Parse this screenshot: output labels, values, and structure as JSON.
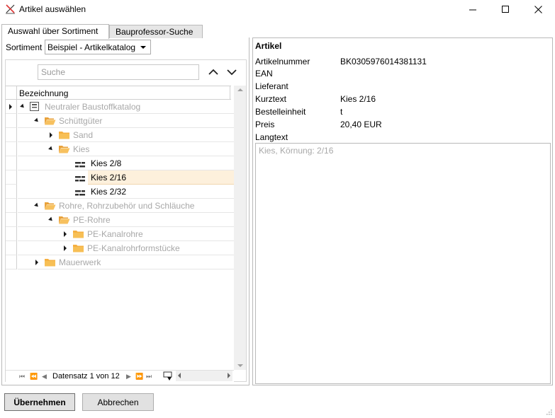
{
  "window": {
    "title": "Artikel auswählen",
    "icons": {
      "app": "pen-ruler-icon",
      "minimize": "minimize-icon",
      "maximize": "maximize-icon",
      "close": "close-icon"
    }
  },
  "tabs": [
    {
      "label": "Auswahl über Sortiment",
      "active": true
    },
    {
      "label": "Bauprofessor-Suche",
      "active": false
    }
  ],
  "sortiment": {
    "label": "Sortiment",
    "selected": "Beispiel - Artikelkatalog"
  },
  "search": {
    "placeholder": "Suche"
  },
  "grid": {
    "column_header": "Bezeichnung",
    "rows": [
      {
        "label": "Neutraler Baustoffkatalog",
        "icon": "catalog-icon",
        "expander": "down",
        "grey": true,
        "selected": false,
        "row_expander": true
      },
      {
        "label": "Schüttgüter",
        "icon": "folder-open-icon",
        "expander": "down",
        "grey": true,
        "selected": false
      },
      {
        "label": "Sand",
        "icon": "folder-icon",
        "expander": "right",
        "grey": true,
        "selected": false
      },
      {
        "label": "Kies",
        "icon": "folder-open-icon",
        "expander": "down",
        "grey": true,
        "selected": false
      },
      {
        "label": "Kies 2/8",
        "icon": "article-icon",
        "expander": "none",
        "grey": false,
        "selected": false
      },
      {
        "label": "Kies 2/16",
        "icon": "article-icon",
        "expander": "none",
        "grey": false,
        "selected": true
      },
      {
        "label": "Kies 2/32",
        "icon": "article-icon",
        "expander": "none",
        "grey": false,
        "selected": false
      },
      {
        "label": "Rohre, Rohrzubehör und Schläuche",
        "icon": "folder-open-icon",
        "expander": "down",
        "grey": true,
        "selected": false
      },
      {
        "label": "PE-Rohre",
        "icon": "folder-open-icon",
        "expander": "down",
        "grey": true,
        "selected": false
      },
      {
        "label": "PE-Kanalrohre",
        "icon": "folder-icon",
        "expander": "right",
        "grey": true,
        "selected": false
      },
      {
        "label": "PE-Kanalrohrformstücke",
        "icon": "folder-icon",
        "expander": "right",
        "grey": true,
        "selected": false
      },
      {
        "label": "Mauerwerk",
        "icon": "folder-icon",
        "expander": "right",
        "grey": true,
        "selected": false
      }
    ]
  },
  "pager": {
    "text": "Datensatz 1 von 12"
  },
  "artikel": {
    "title": "Artikel",
    "fields": [
      {
        "label": "Artikelnummer",
        "value": "BK0305976014381131"
      },
      {
        "label": "EAN",
        "value": ""
      },
      {
        "label": "Lieferant",
        "value": ""
      },
      {
        "label": "Kurztext",
        "value": "Kies 2/16"
      },
      {
        "label": "Bestelleinheit",
        "value": "t"
      },
      {
        "label": "Preis",
        "value": "20,40 EUR"
      },
      {
        "label": "Langtext",
        "value": ""
      }
    ],
    "langtext": "Kies, Körnung: 2/16"
  },
  "buttons": {
    "apply": "Übernehmen",
    "cancel": "Abbrechen"
  },
  "colors": {
    "folder": "#f5b041",
    "selected_row": "#fdf0dc",
    "grey_text": "#a8a8a8"
  }
}
